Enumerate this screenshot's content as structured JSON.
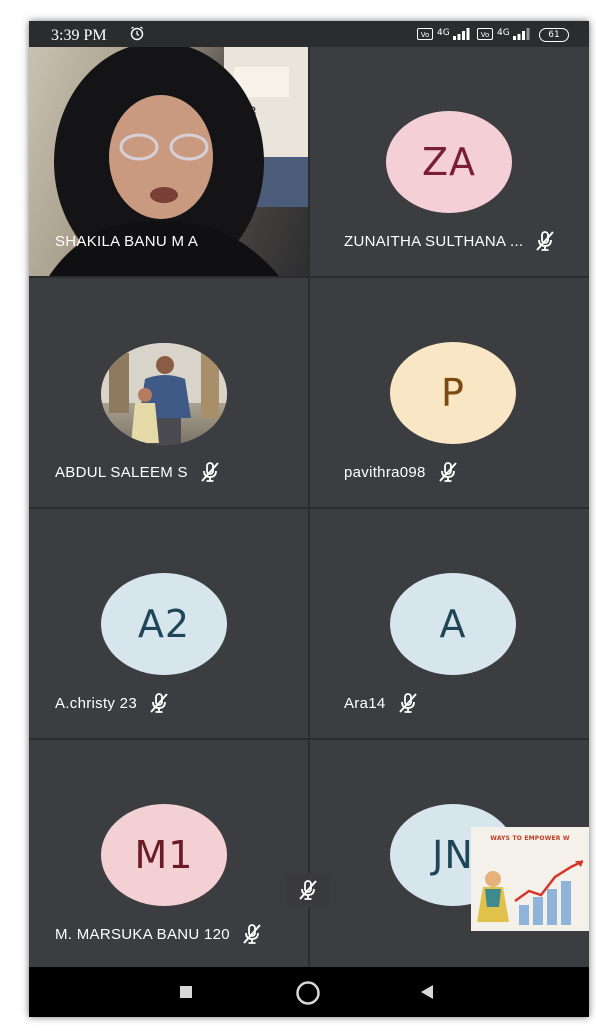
{
  "status_bar": {
    "time": "3:39 PM",
    "battery": "61",
    "signal_1": "4G",
    "signal_2": "4G"
  },
  "participants": [
    {
      "name": "SHAKILA BANU M A",
      "initials": "",
      "video": true,
      "muted": false
    },
    {
      "name": "ZUNAITHA SULTHANA ...",
      "initials": "ZA",
      "avatar_bg": "#f4cfd6",
      "avatar_fg": "#7a1f33",
      "muted": true
    },
    {
      "name": "ABDUL SALEEM S",
      "initials": "",
      "photo": true,
      "muted": true
    },
    {
      "name": "pavithra098",
      "initials": "P",
      "avatar_bg": "#f8e6c4",
      "avatar_fg": "#7a4a10",
      "muted": true
    },
    {
      "name": "A.christy 23",
      "initials": "A2",
      "avatar_bg": "#d7e6ec",
      "avatar_fg": "#1f4658",
      "muted": true
    },
    {
      "name": "Ara14",
      "initials": "A",
      "avatar_bg": "#d7e6ec",
      "avatar_fg": "#1f4658",
      "muted": true
    },
    {
      "name": "M. MARSUKA BANU 120",
      "initials": "M1",
      "avatar_bg": "#f3d0d4",
      "avatar_fg": "#6b1b26",
      "muted": true
    },
    {
      "name": "",
      "initials": "JN",
      "avatar_bg": "#d7e6ec",
      "avatar_fg": "#1f4658",
      "muted": false
    }
  ],
  "presentation": {
    "title": "WAYS TO EMPOWER W"
  },
  "colors": {
    "tile_bg": "#3c3d40",
    "screen_bg": "#2b2c2e",
    "nav_bg": "#000000"
  }
}
